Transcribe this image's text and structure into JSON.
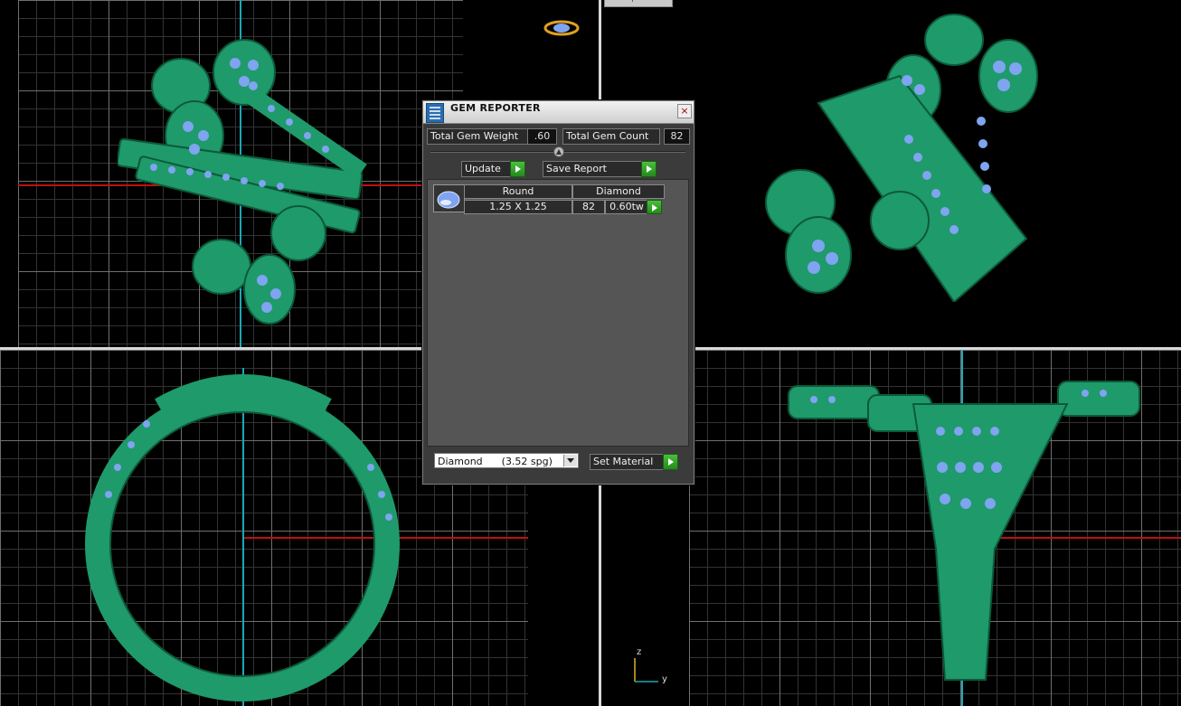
{
  "viewports": {
    "top_right_tab": "Perspective"
  },
  "gem_reporter": {
    "title": "GEM REPORTER",
    "total_gem_weight_label": "Total Gem Weight",
    "total_gem_weight_value": ".60",
    "total_gem_count_label": "Total Gem Count",
    "total_gem_count_value": "82",
    "update_label": "Update",
    "save_report_label": "Save Report",
    "columns": {
      "shape": "Round",
      "material": "Diamond"
    },
    "row": {
      "size": "1.25 X 1.25",
      "count": "82",
      "weight": "0.60tw"
    },
    "material_select_value": "Diamond      (3.52 spg)",
    "set_material_label": "Set Material"
  },
  "axes_gizmo": {
    "z_label": "z",
    "y_label": "y"
  },
  "colors": {
    "metal": "#1f9a6a",
    "gem": "#7fa4f0",
    "x_axis": "#c01010",
    "y_axis": "#1aa8b8",
    "accent_green": "#2ea827"
  }
}
